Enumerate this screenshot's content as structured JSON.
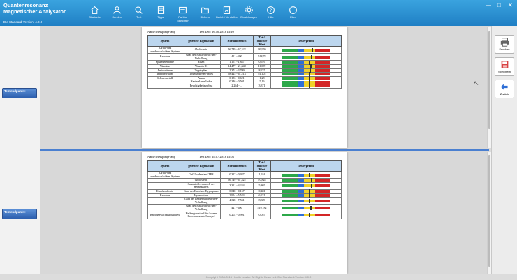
{
  "app": {
    "title_line1": "Quantenresonanz",
    "title_line2": "Magnetischer Analysator",
    "version": "Die Standard-Version: 4.0.0"
  },
  "nav": [
    {
      "label": "Startseite",
      "icon": "home-icon"
    },
    {
      "label": "Kunden",
      "icon": "customers-icon"
    },
    {
      "label": "Test",
      "icon": "search-icon"
    },
    {
      "label": "Tipps",
      "icon": "document-icon"
    },
    {
      "label": "Partitur Einrichten",
      "icon": "settings-icon"
    },
    {
      "label": "Sichern",
      "icon": "folder-icon"
    },
    {
      "label": "Bericht Verstellen",
      "icon": "report-icon"
    },
    {
      "label": "Einstellungen",
      "icon": "gear-icon"
    },
    {
      "label": "Hilfe",
      "icon": "help-icon"
    },
    {
      "label": "Über",
      "icon": "info-icon"
    }
  ],
  "left": {
    "testpoint_label": "Testendpunkt:",
    "testpoint_sub": "",
    "testpoint_label_2": "Testendpunkt:"
  },
  "colors": {
    "accent": "#1f7fc4",
    "header_bg": "#bcd6ee",
    "bar_green": "#2da84a",
    "bar_yellow": "#f0d22a",
    "bar_red": "#d32626",
    "bar_blue": "#2f6fd6"
  },
  "report1": {
    "name": "Name: Beispiel(Frau)",
    "time": "Test Zeit: 16.10.2013 13:10",
    "columns": [
      "System",
      "getestete Eigenschaft",
      "Normalbereich",
      "Tats?chlicher Wert",
      "Testergebnis"
    ],
    "rows": [
      {
        "system": "Kardio-und zerebrovaskuläres System",
        "property": "Cholesterin",
        "range": "56,749 - 67,522",
        "value": "69,959",
        "level": 0.62
      },
      {
        "system": "Knochen",
        "property": "Grad der Halswirbelh?hen-Verkalkung",
        "range": "421 - 490",
        "value": "518,78",
        "level": 0.6
      },
      {
        "system": "Spurenelemente",
        "property": "Eisen",
        "range": "1,151 - 1,847",
        "value": "0,676",
        "level": 0.55
      },
      {
        "system": "Vitamine",
        "property": "Vitamin B3",
        "range": "14,477 - 21,348",
        "value": "11,089",
        "level": 0.58
      },
      {
        "system": "Aminosäuren",
        "property": "Tryptophan",
        "range": "2,374 - 3,709",
        "value": "8,237",
        "level": 0.57
      },
      {
        "system": "Immunsystem",
        "property": "Thymusdr?sen-Index",
        "range": "58,425 - 61,213",
        "value": "51,102",
        "level": 0.56
      },
      {
        "system": "Schwermetall",
        "property": "Arsen",
        "range": "0,153 - 0,621",
        "value": "1,28",
        "level": 0.55
      },
      {
        "system": "",
        "property": "Hautmelanin Index",
        "range": "0,346 - 0,501",
        "value": "5,16",
        "level": 0.55
      },
      {
        "system": "",
        "property": "Feuchtigkeitsverlust",
        "range": "2,264 - ...",
        "value": "3,371",
        "level": 0.55
      }
    ]
  },
  "report2": {
    "name": "Name: Beispiel(Frau)",
    "time": "Test Zeit: 18.07.2013 13:04",
    "columns": [
      "System",
      "getestete Eigenschaft",
      "Normalbereich",
      "Tats?chlicher Wert",
      "Testergebnis"
    ],
    "rows": [
      {
        "system": "Kardio-und zerebrovaskuläres System",
        "property": "Gef??widerstand TPR",
        "range": "0,327 - 0,937",
        "value": "1,634",
        "level": 0.55
      },
      {
        "system": "",
        "property": "Cholesterin",
        "range": "56,749 - 67,522",
        "value": "70,828",
        "level": 0.6
      },
      {
        "system": "",
        "property": "Sauerstoffverbrauch des Herzmuskels",
        "range": "3,321 - 4,244",
        "value": "5,865",
        "level": 0.6
      },
      {
        "system": "Knochendichte",
        "property": "Grad der Knochen-Hyperplasie",
        "range": "0,048 - 0,167",
        "value": "0,481",
        "level": 0.55
      },
      {
        "system": "Knochen",
        "property": "Hyperostose",
        "range": "2,954 - 5,543",
        "value": "6,221",
        "level": 0.55
      },
      {
        "system": "",
        "property": "Grad der Lendenwirbelh?hen-Verkalkung",
        "range": "4,328 - 7,531",
        "value": "8,309",
        "level": 0.55
      },
      {
        "system": "",
        "property": "Grad der Halswirbelh?hen-Verkalkung",
        "range": "421 - 490",
        "value": "519,782",
        "level": 0.58
      },
      {
        "system": "Knochenwachstums Index",
        "property": "Heilungszustand der kurzen Knochen sowie Knorpel",
        "range": "0,202 - 0,991",
        "value": "0,057",
        "level": 0.55
      }
    ]
  },
  "right": {
    "print_label": "Drucken",
    "save_label": "Speichern",
    "back_label": "Zurück"
  },
  "footer": "Copyright 2008-2016 Health Leader. All Rights Reserved. Die Standard-Version 4.0.0"
}
